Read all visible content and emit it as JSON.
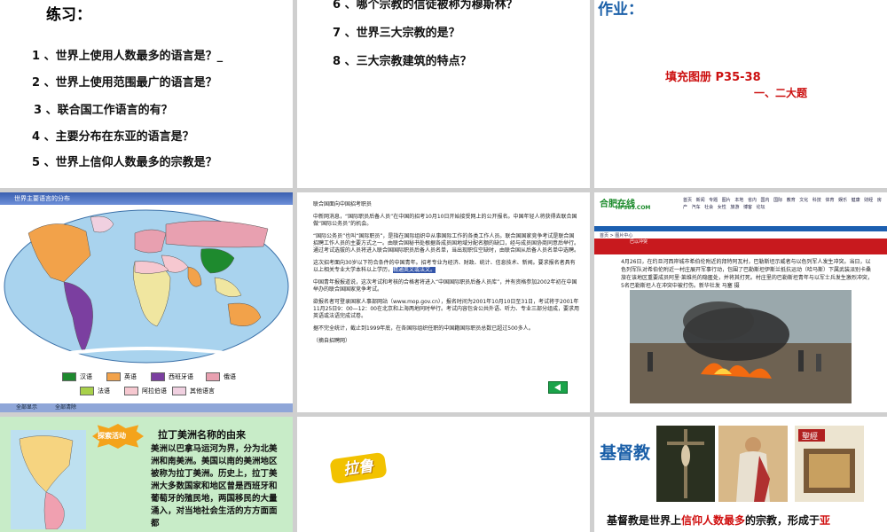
{
  "slide1": {
    "title": "练习：",
    "questions": [
      "1 、世界上使用人数最多的语言是？_",
      "2 、世界上使用范围最广的语言是？",
      "3 、联合国工作语言的有？",
      "4 、主要分布在东亚的语言是？",
      "5 、世界上信仰人数最多的宗教是？"
    ]
  },
  "slide2": {
    "questions": [
      "6 、哪个宗教的信徒被称为穆斯林？",
      "7 、世界三大宗教的是？",
      "8 、三大宗教建筑的特点？"
    ]
  },
  "slide3": {
    "title": "作业：",
    "line1": "填充图册 P35-38",
    "line2": "一、二大题"
  },
  "slide4": {
    "header": "世界主要语言的分布",
    "legend": [
      "汉语",
      "英语",
      "西班牙语",
      "俄语",
      "法语",
      "阿拉伯语",
      "其他语言"
    ],
    "legend_colors": [
      "#1e8a2e",
      "#f2a24a",
      "#7b3fa0",
      "#e8a0b0",
      "#a8d04a",
      "#f6c8d0",
      "#f0d0e0"
    ],
    "footer": [
      "全部显示",
      "全部清除"
    ]
  },
  "slide5": {
    "heading": "联合国面向中国招考职员",
    "paragraphs": [
      "中新网消息，“国际职员后备人员”在中国的招考10月10日开始接受网上的公开报名。中国年轻人将获得去联合国做“国际公务员”的机会。",
      "“国际公务员”也叫“国际职员”，是指在国际组织中从事国际工作的各类工作人员。联合国国家竞争考试是联合国招聘工作人员的主要方式之一。由联合国秘书处根据各成员国地域分配名额的缺口，经与成员国协商同意后举行。通过考试选拔的人员将进入联合国国际职员后备人员名单，当出现职位空缺时，由联合国从后备人员名单中选聘。",
      "这次招考面向30岁以下符合条件的中国青年。招考专业为经济、财政、统计、信息技术、新闻。要求报名者具有以上相关专业大学本科以上学历，",
      "中国青年报报道说，这次考试和考核的合格者将进入“中国国际职员后备人员库”，并有资格参加2002年初在中国举办的联合国国家竞争考试。",
      "欲报名者可登录国家人事部网站（www.mop.gov.cn），报名时间为2001年10月10日至31日，考试将于2001年11月25日9：00—12：00在北京和上海两地同时举行。考试内容包含公共外语、听力、专业三部分组成，要求用英语或法语完成试卷。",
      "据不完全统计，截止到1999年底，在各国际组织任职的中国籍国际职员总数已超过500多人。",
      "（摘自招聘网）"
    ],
    "highlight": "精通英文或法文。"
  },
  "slide6": {
    "logo": "合肥在线",
    "logo_sub": "HF365.COM",
    "nav": "首页 新闻 专题 图片 本地 省内 国内 国际 教育 文化 科技 体育 娱乐 健康 财经 房产 汽车 社会 女性 旅游 博客 论坛",
    "channel": "首页 > 图片中心",
    "headline": "巴以冲突",
    "news": "4月26日，在约旦河西岸城市希伯伦附近的拜特阿瓦村，巴勒斯坦示威者与以色列军人发生冲突。当日，以色列军队对希伯伦附近一村庄展开军事行动，包围了巴勒斯坦伊斯兰抵抗运动（哈马斯）下属武装派别卡桑旅在该地区重要成员阿里·莱维托的隐匿处，并将其打死。村庄里的巴勒斯坦青年与以军士兵发生激烈冲突，5名巴勒斯坦人在冲突中被打伤。新华社发 马塞 摄"
  },
  "slide7": {
    "badge": "探索活动",
    "title": "拉丁美洲名称的由来",
    "body": "美洲以巴拿马运河为界，分为北美洲和南美洲。美国以南的美洲地区被称为拉丁美洲。历史上，拉丁美洲大多数国家和地区曾是西班牙和葡萄牙的殖民地，两国移民的大量涌入，对当地社会生活的方方面面都"
  },
  "slide8": {
    "label": "拉鲁"
  },
  "slide9": {
    "title": "基督教",
    "caption_pre": "基督教是世界上",
    "caption_red": "信仰人数最多",
    "caption_post": "的宗教，形成于",
    "caption_end": "亚"
  }
}
